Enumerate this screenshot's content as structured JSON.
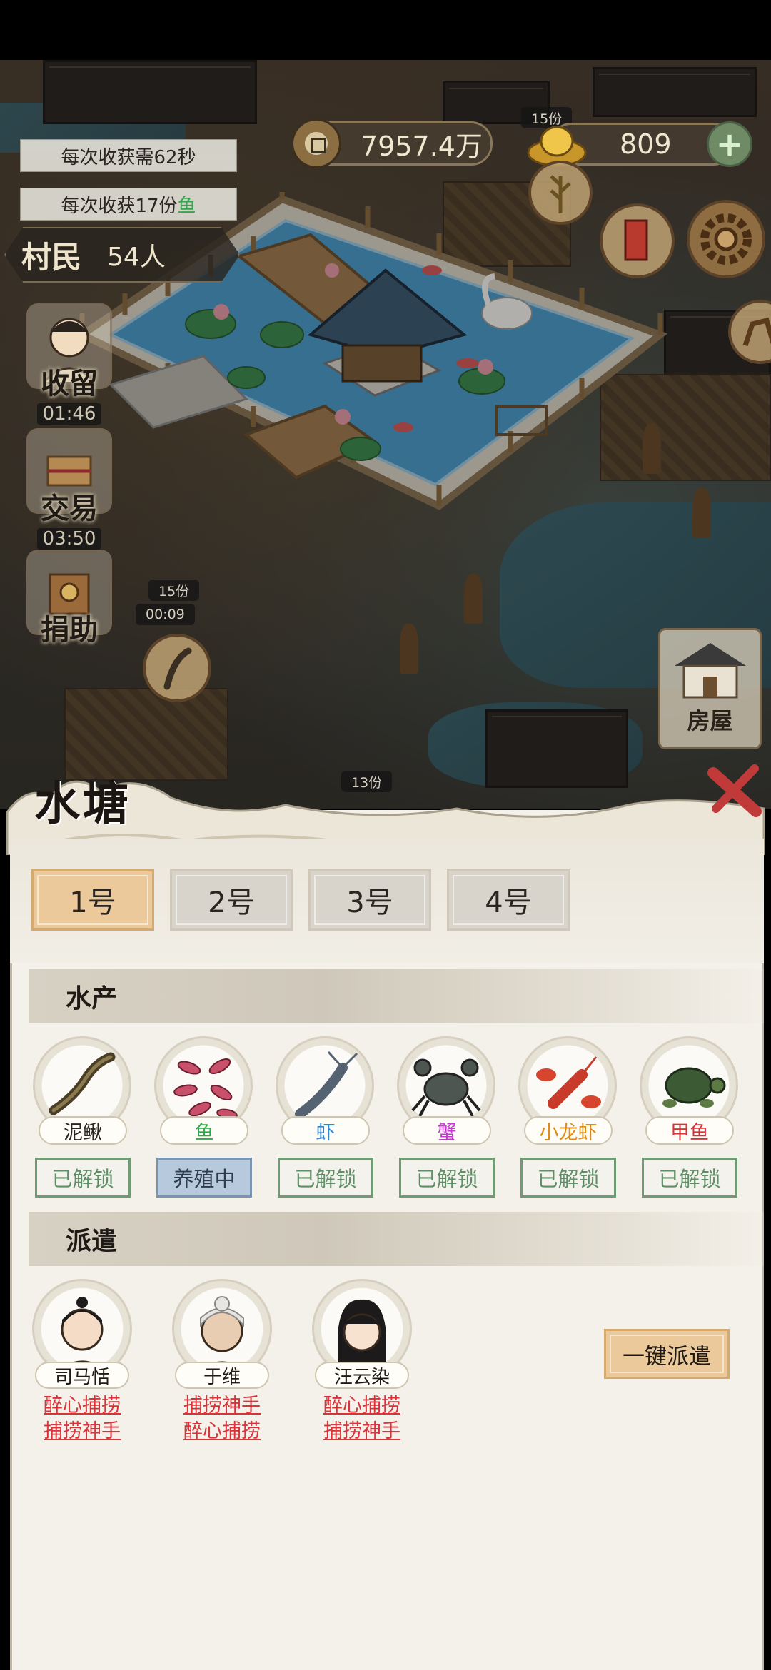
{
  "colors": {
    "accent_tab": "#ecc99a",
    "unlocked_green": "#5f8e67",
    "breeding_blue": "#b7c9dc",
    "skill_red": "#d9333a"
  },
  "hud": {
    "harvest_time": "每次收获需62秒",
    "harvest_amount_prefix": "每次收获17份",
    "harvest_amount_item": "鱼",
    "coins": "7957.4万",
    "ingots": "809",
    "ingot_tag": "15份",
    "plus_icon": "plus-icon",
    "villagers_label": "村民",
    "villagers_count": "54人"
  },
  "side_buttons": [
    {
      "name": "收留",
      "time": "01:46"
    },
    {
      "name": "交易",
      "time": "03:50"
    },
    {
      "name": "捐助",
      "time": ""
    }
  ],
  "map_tags": {
    "tag1_amount": "15份",
    "tag1_time": "00:09",
    "tag2_amount": "13份",
    "house_label": "房屋"
  },
  "panel": {
    "title": "水塘",
    "tabs": [
      {
        "label": "1号",
        "active": true
      },
      {
        "label": "2号",
        "active": false
      },
      {
        "label": "3号",
        "active": false
      },
      {
        "label": "4号",
        "active": false
      }
    ],
    "aquatic_section": "水产",
    "products": [
      {
        "name": "泥鳅",
        "color": "#2a2520",
        "state": "已解锁",
        "active": false,
        "icon": "loach-icon"
      },
      {
        "name": "鱼",
        "color": "#2fa84a",
        "state": "养殖中",
        "active": true,
        "icon": "fish-icon"
      },
      {
        "name": "虾",
        "color": "#2f86d6",
        "state": "已解锁",
        "active": false,
        "icon": "shrimp-icon"
      },
      {
        "name": "蟹",
        "color": "#c43bd0",
        "state": "已解锁",
        "active": false,
        "icon": "crab-icon"
      },
      {
        "name": "小龙虾",
        "color": "#e08a18",
        "state": "已解锁",
        "active": false,
        "icon": "crayfish-icon"
      },
      {
        "name": "甲鱼",
        "color": "#d9333a",
        "state": "已解锁",
        "active": false,
        "icon": "turtle-icon"
      }
    ],
    "dispatch_section": "派遣",
    "workers": [
      {
        "name": "司马恬",
        "skills": [
          "醉心捕捞",
          "捕捞神手"
        ]
      },
      {
        "name": "于维",
        "skills": [
          "捕捞神手",
          "醉心捕捞"
        ]
      },
      {
        "name": "汪云染",
        "skills": [
          "醉心捕捞",
          "捕捞神手"
        ]
      }
    ],
    "one_click_dispatch": "一键派遣"
  }
}
